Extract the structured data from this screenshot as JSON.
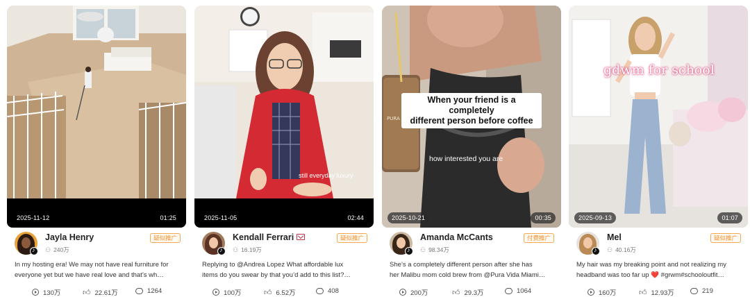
{
  "cards": [
    {
      "date": "2025-11-12",
      "duration": "01:25",
      "overlay": {},
      "name": "Jayla Henry",
      "followers": "240万",
      "tag": "疑似推广",
      "desc": [
        "In my hosting era! We may not have real furniture for",
        "everyone yet but we have real love and that’s wh…"
      ],
      "plays": "130万",
      "likes": "22.61万",
      "comments": "1264"
    },
    {
      "date": "2025-11-05",
      "duration": "02:44",
      "overlay": {
        "text": "still everyday luxury"
      },
      "name": "Kendall Ferrari",
      "followers": "16.19万",
      "tag": "疑似推广",
      "desc": [
        "Replying to @Andrea Lopez What affordable lux",
        "items do you swear by that you’d add to this list?…"
      ],
      "plays": "100万",
      "likes": "6.52万",
      "comments": "408"
    },
    {
      "date": "2025-10-21",
      "duration": "00:35",
      "overlay": {
        "caption_line1": "When your friend is a completely",
        "caption_line2": "different person before coffee",
        "text": "how interested you are",
        "cup_label": "PURA VIDA"
      },
      "name": "Amanda McCants",
      "followers": "98.34万",
      "tag": "付费推广",
      "desc": [
        "She’s a completely different person after she has",
        "her Malibu mom cold brew from @Pura Vida Miami…"
      ],
      "plays": "200万",
      "likes": "29.3万",
      "comments": "1064"
    },
    {
      "date": "2025-09-13",
      "duration": "01:07",
      "overlay": {
        "title": "gdwm for school"
      },
      "name": "Mel",
      "followers": "40.16万",
      "tag": "疑似推广",
      "desc": [
        "My hair was my breaking point and not realizing my",
        "headband was too far up ❤️ #grwm#schooloutfit…"
      ],
      "plays": "160万",
      "likes": "12.93万",
      "comments": "219"
    }
  ],
  "colors": {
    "tag_orange": "#f0902a",
    "play_blue": "#1f6fd6"
  },
  "icons": [
    "play-count-icon",
    "like-icon",
    "comment-icon",
    "followers-icon",
    "tiktok-badge-icon",
    "mail-icon"
  ]
}
